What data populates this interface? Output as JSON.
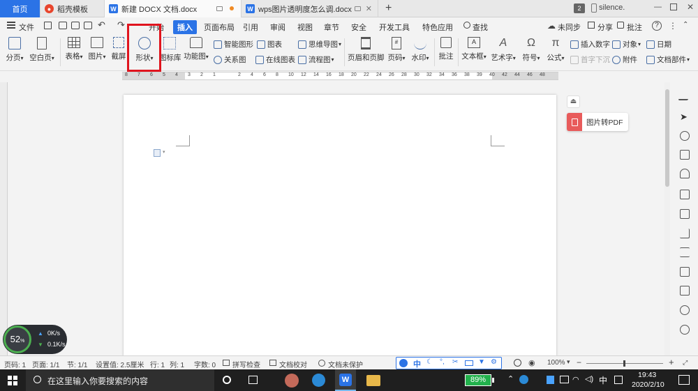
{
  "tabs": {
    "home": "首页",
    "template": "稻壳模板",
    "doc1": "新建 DOCX 文档.docx",
    "doc2": "wps图片透明度怎么调.docx",
    "new_tab": "+",
    "window_count": "2",
    "user": "silence."
  },
  "menu": {
    "file": "文件",
    "start": "开始",
    "insert": "插入",
    "page_layout": "页面布局",
    "reference": "引用",
    "review": "审阅",
    "view": "视图",
    "section": "章节",
    "security": "安全",
    "dev_tools": "开发工具",
    "special": "特色应用",
    "search": "查找",
    "unsync": "未同步",
    "share": "分享",
    "annotate": "批注",
    "help": "?"
  },
  "ribbon": {
    "page_break": "分页",
    "blank_page": "空白页",
    "table": "表格",
    "picture": "图片",
    "screenshot": "截屏",
    "shape": "形状",
    "icon_lib": "图标库",
    "func_chart": "功能图",
    "smart_graphic": "智能图形",
    "chart": "图表",
    "mind_map": "思维导图",
    "relation": "关系图",
    "online_chart": "在线图表",
    "flowchart": "流程图",
    "header_footer": "页眉和页脚",
    "page_num": "页码",
    "watermark": "水印",
    "comment": "批注",
    "textbox": "文本框",
    "wordart": "艺术字",
    "symbol": "符号",
    "formula": "公式",
    "insert_number": "插入数字",
    "drop_cap": "首字下沉",
    "object": "对象",
    "attachment": "附件",
    "date": "日期",
    "doc_parts": "文档部件"
  },
  "ruler_numbers": [
    "8",
    "7",
    "6",
    "5",
    "4",
    "3",
    "2",
    "1",
    "",
    "2",
    "4",
    "6",
    "8",
    "10",
    "12",
    "14",
    "16",
    "18",
    "20",
    "22",
    "24",
    "26",
    "28",
    "30",
    "32",
    "34",
    "36",
    "38",
    "39",
    "40",
    "42",
    "44",
    "46",
    "48"
  ],
  "float_panel": {
    "pdf_label": "图片转PDF"
  },
  "status": {
    "page_code": "页码: 1",
    "pages": "页面: 1/1",
    "section": "节: 1/1",
    "setting": "设置值: 2.5厘米",
    "row": "行: 1",
    "col": "列: 1",
    "words": "字数: 0",
    "spell": "拼写检查",
    "proof": "文档校对",
    "protect": "文档未保护",
    "zoom": "100%",
    "zoom_minus": "−",
    "zoom_plus": "+"
  },
  "speed_widget": {
    "percent": "52",
    "percent_sign": "%",
    "up": "0K/s",
    "down": "0.1K/s"
  },
  "taskbar": {
    "search_placeholder": "在这里输入你要搜索的内容",
    "battery": "89%",
    "ime": "中",
    "time": "19:43",
    "date": "2020/2/10"
  },
  "colors": {
    "accent": "#2b73e6",
    "highlight": "#e0141e",
    "pdf_icon": "#e85b5b"
  }
}
